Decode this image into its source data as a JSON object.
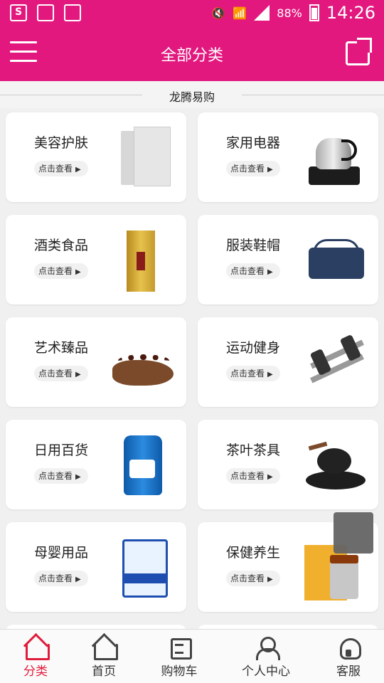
{
  "status": {
    "battery": "88%",
    "time": "14:26"
  },
  "header": {
    "title": "全部分类"
  },
  "section": {
    "title": "龙腾易购"
  },
  "categories": [
    {
      "name": "美容护肤",
      "action": "点击查看"
    },
    {
      "name": "家用电器",
      "action": "点击查看"
    },
    {
      "name": "酒类食品",
      "action": "点击查看"
    },
    {
      "name": "服装鞋帽",
      "action": "点击查看"
    },
    {
      "name": "艺术臻品",
      "action": "点击查看"
    },
    {
      "name": "运动健身",
      "action": "点击查看"
    },
    {
      "name": "日用百货",
      "action": "点击查看"
    },
    {
      "name": "茶叶茶具",
      "action": "点击查看"
    },
    {
      "name": "母婴用品",
      "action": "点击查看"
    },
    {
      "name": "保健养生",
      "action": "点击查看"
    }
  ],
  "tabs": [
    {
      "label": "分类",
      "icon": "home-icon",
      "active": true
    },
    {
      "label": "首页",
      "icon": "home-icon"
    },
    {
      "label": "购物车",
      "icon": "cart-icon"
    },
    {
      "label": "个人中心",
      "icon": "user-icon"
    },
    {
      "label": "客服",
      "icon": "headset-icon"
    }
  ],
  "colors": {
    "brand": "#e2187f",
    "tab_active": "#e01c3c"
  }
}
